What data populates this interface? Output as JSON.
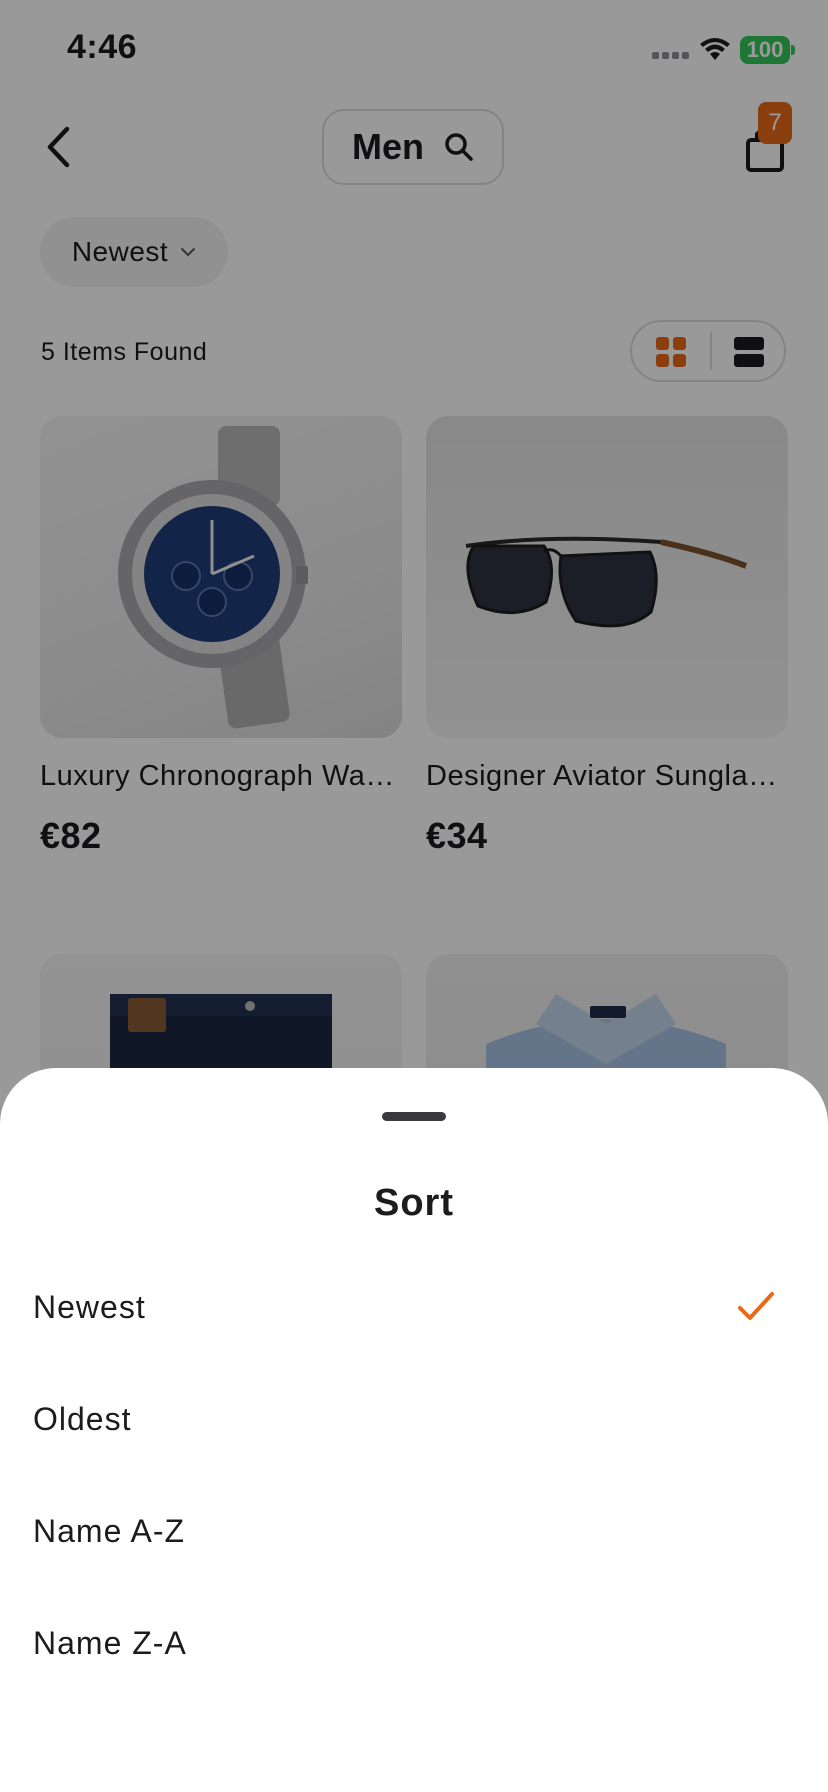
{
  "status_bar": {
    "time": "4:46",
    "battery": "100"
  },
  "header": {
    "title": "Men",
    "cart_count": "7"
  },
  "filter": {
    "sort_label": "Newest",
    "items_found": "5 Items Found"
  },
  "products": [
    {
      "name": "Luxury Chronograph Wa…",
      "price": "€82"
    },
    {
      "name": "Designer Aviator Sungla…",
      "price": "€34"
    },
    {
      "name": "",
      "price": ""
    },
    {
      "name": "",
      "price": ""
    }
  ],
  "sort_sheet": {
    "title": "Sort",
    "options": [
      "Newest",
      "Oldest",
      "Name A-Z",
      "Name Z-A"
    ],
    "selected": "Newest"
  },
  "colors": {
    "accent": "#e8691a",
    "battery": "#34c759",
    "text": "#1c1c1e"
  },
  "icons": [
    "back-chevron-icon",
    "search-icon",
    "shopping-bag-icon",
    "chevron-down-icon",
    "grid-view-icon",
    "list-view-icon",
    "checkmark-icon",
    "wifi-icon",
    "cellular-signal-icon",
    "battery-icon"
  ]
}
